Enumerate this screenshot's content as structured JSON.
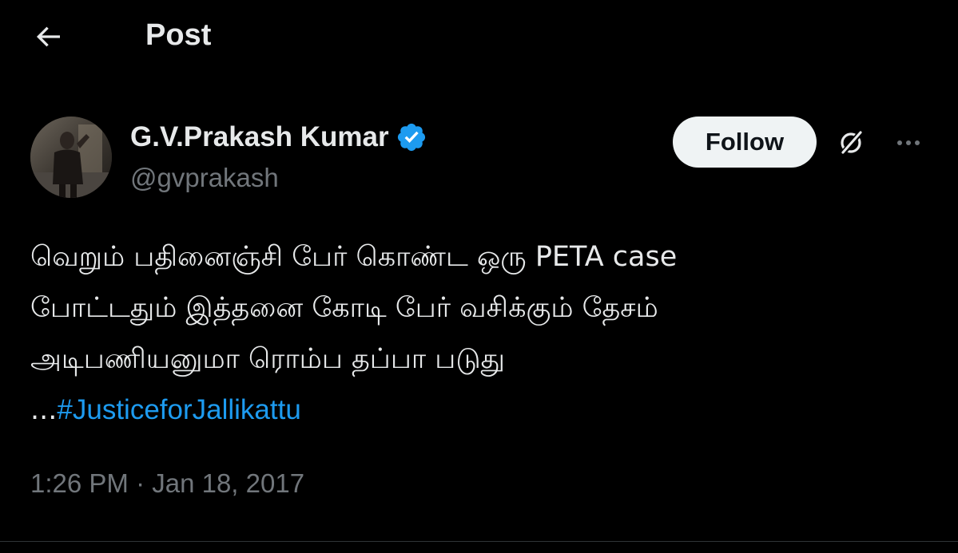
{
  "header": {
    "title": "Post",
    "back_icon": "arrow-left-icon"
  },
  "author": {
    "display_name": "G.V.Prakash Kumar",
    "handle": "@gvprakash",
    "verified_icon": "verified-badge-icon",
    "verified_color": "#1d9bf0"
  },
  "actions": {
    "follow_label": "Follow",
    "grok_icon": "grok-icon",
    "more_icon": "more-horizontal-icon"
  },
  "tweet": {
    "lines": [
      "வெறும் பதினைஞ்சி பேர் கொண்ட ஒரு PETA case",
      "போட்டதும் இத்தனை கோடி பேர் வசிக்கும் தேசம்",
      "அடிபணியனுமா ரொம்ப தப்பா படுது"
    ],
    "ellipsis": "...",
    "hashtag": "#JusticeforJallikattu",
    "hashtag_color": "#1d9bf0"
  },
  "timestamp": "1:26 PM · Jan 18, 2017",
  "colors": {
    "background": "#000000",
    "text_primary": "#e7e9ea",
    "text_secondary": "#71767b",
    "follow_bg": "#eff3f4"
  }
}
